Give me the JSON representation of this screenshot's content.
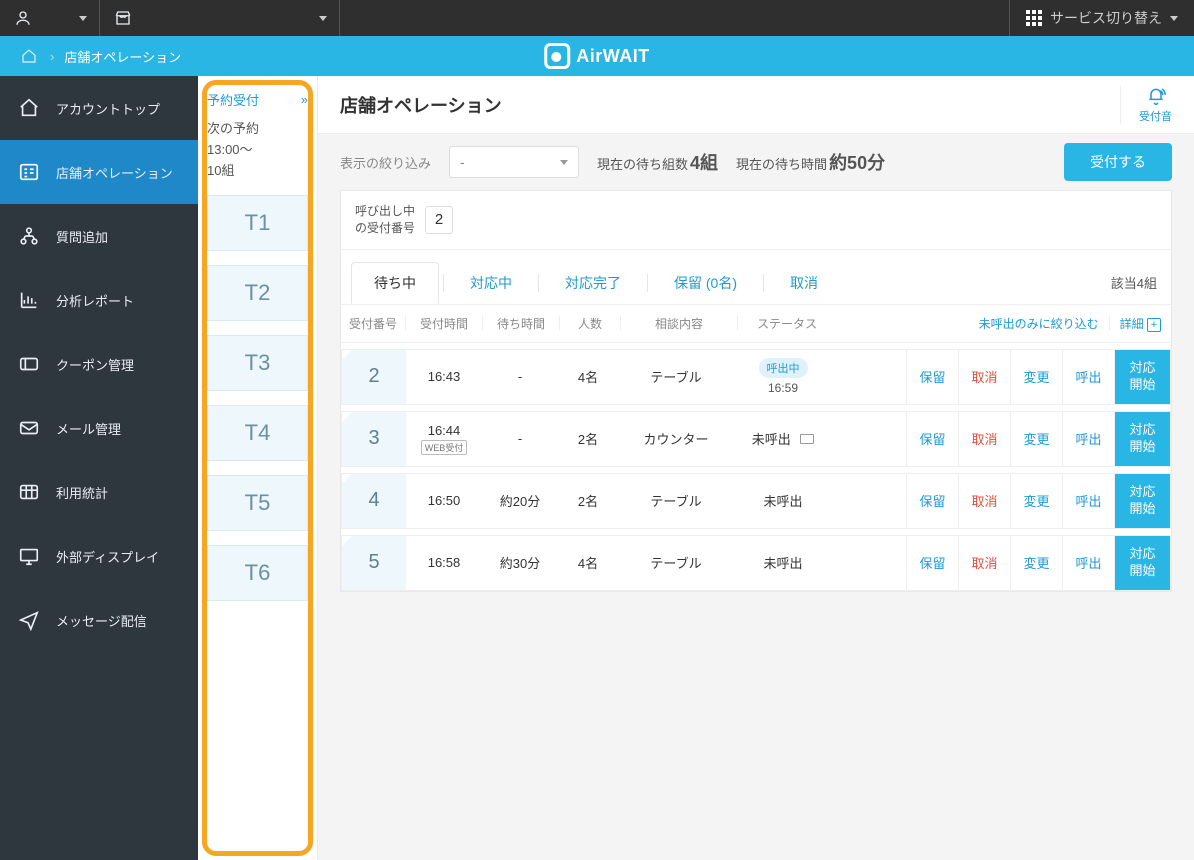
{
  "topbar": {
    "service_switch": "サービス切り替え"
  },
  "breadcrumb": {
    "current": "店舗オペレーション",
    "app_name": "AirWAIT"
  },
  "sidebar": {
    "items": [
      {
        "label": "アカウントトップ"
      },
      {
        "label": "店舗オペレーション"
      },
      {
        "label": "質問追加"
      },
      {
        "label": "分析レポート"
      },
      {
        "label": "クーポン管理"
      },
      {
        "label": "メール管理"
      },
      {
        "label": "利用統計"
      },
      {
        "label": "外部ディスプレイ"
      },
      {
        "label": "メッセージ配信"
      }
    ]
  },
  "reserve_panel": {
    "link": "予約受付",
    "next_label": "次の予約",
    "next_time": "13:00〜",
    "next_count": "10組",
    "tiles": [
      "T1",
      "T2",
      "T3",
      "T4",
      "T5",
      "T6"
    ]
  },
  "header": {
    "title": "店舗オペレーション",
    "sound": "受付音"
  },
  "filter": {
    "label": "表示の絞り込み",
    "select_value": "-",
    "waiting_groups_label": "現在の待ち組数",
    "waiting_groups_value": "4組",
    "waiting_time_label": "現在の待ち時間",
    "waiting_time_value": "約50分",
    "accept": "受付する"
  },
  "calling": {
    "label1": "呼び出し中",
    "label2": "の受付番号",
    "value": "2"
  },
  "tabs": {
    "items": [
      {
        "label": "待ち中"
      },
      {
        "label": "対応中"
      },
      {
        "label": "対応完了"
      },
      {
        "label": "保留 (0名)"
      },
      {
        "label": "取消"
      }
    ],
    "total": "該当4組"
  },
  "thead": {
    "no": "受付番号",
    "time": "受付時間",
    "wait": "待ち時間",
    "ppl": "人数",
    "consult": "相談内容",
    "status": "ステータス",
    "filter_link": "未呼出のみに絞り込む",
    "detail": "詳細"
  },
  "actions": {
    "hold": "保留",
    "cancel": "取消",
    "change": "変更",
    "call": "呼出",
    "start": "対応開始"
  },
  "status_labels": {
    "calling": "呼出中",
    "uncalled": "未呼出",
    "web": "WEB受付"
  },
  "rows": [
    {
      "no": "2",
      "time": "16:43",
      "web": false,
      "wait": "-",
      "ppl": "4名",
      "consult": "テーブル",
      "status": "calling",
      "status_time": "16:59",
      "mail": false
    },
    {
      "no": "3",
      "time": "16:44",
      "web": true,
      "wait": "-",
      "ppl": "2名",
      "consult": "カウンター",
      "status": "uncalled",
      "status_time": "",
      "mail": true
    },
    {
      "no": "4",
      "time": "16:50",
      "web": false,
      "wait": "約20分",
      "ppl": "2名",
      "consult": "テーブル",
      "status": "uncalled",
      "status_time": "",
      "mail": false
    },
    {
      "no": "5",
      "time": "16:58",
      "web": false,
      "wait": "約30分",
      "ppl": "4名",
      "consult": "テーブル",
      "status": "uncalled",
      "status_time": "",
      "mail": false
    }
  ]
}
